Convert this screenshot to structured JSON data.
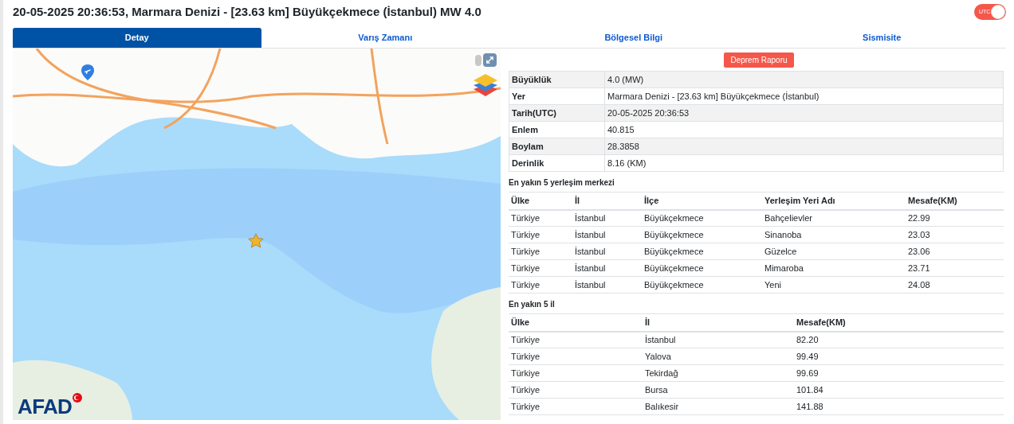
{
  "title": "20-05-2025 20:36:53, Marmara Denizi - [23.63 km] Büyükçekmece (İstanbul) MW 4.0",
  "utc_toggle": {
    "label": "UTC",
    "on": true
  },
  "tabs": [
    {
      "label": "Detay",
      "selected": true
    },
    {
      "label": "Varış Zamanı",
      "selected": false
    },
    {
      "label": "Bölgesel Bilgi",
      "selected": false
    },
    {
      "label": "Sismisite",
      "selected": false
    }
  ],
  "map": {
    "logo": "AFAD"
  },
  "report_button": "Deprem Raporu",
  "details": [
    {
      "label": "Büyüklük",
      "value": "4.0 (MW)"
    },
    {
      "label": "Yer",
      "value": "Marmara Denizi - [23.63 km] Büyükçekmece (İstanbul)"
    },
    {
      "label": "Tarih(UTC)",
      "value": "20-05-2025 20:36:53"
    },
    {
      "label": "Enlem",
      "value": "40.815"
    },
    {
      "label": "Boylam",
      "value": "28.3858"
    },
    {
      "label": "Derinlik",
      "value": "8.16 (KM)"
    }
  ],
  "settlements": {
    "title": "En yakın 5 yerleşim merkezi",
    "columns": [
      "Ülke",
      "İl",
      "İlçe",
      "Yerleşim Yeri Adı",
      "Mesafe(KM)"
    ],
    "rows": [
      [
        "Türkiye",
        "İstanbul",
        "Büyükçekmece",
        "Bahçelievler",
        "22.99"
      ],
      [
        "Türkiye",
        "İstanbul",
        "Büyükçekmece",
        "Sinanoba",
        "23.03"
      ],
      [
        "Türkiye",
        "İstanbul",
        "Büyükçekmece",
        "Güzelce",
        "23.06"
      ],
      [
        "Türkiye",
        "İstanbul",
        "Büyükçekmece",
        "Mimaroba",
        "23.71"
      ],
      [
        "Türkiye",
        "İstanbul",
        "Büyükçekmece",
        "Yeni",
        "24.08"
      ]
    ]
  },
  "provinces": {
    "title": "En yakın 5 il",
    "columns": [
      "Ülke",
      "İl",
      "Mesafe(KM)"
    ],
    "rows": [
      [
        "Türkiye",
        "İstanbul",
        "82.20"
      ],
      [
        "Türkiye",
        "Yalova",
        "99.49"
      ],
      [
        "Türkiye",
        "Tekirdağ",
        "99.69"
      ],
      [
        "Türkiye",
        "Bursa",
        "101.84"
      ],
      [
        "Türkiye",
        "Balıkesir",
        "141.88"
      ]
    ]
  }
}
